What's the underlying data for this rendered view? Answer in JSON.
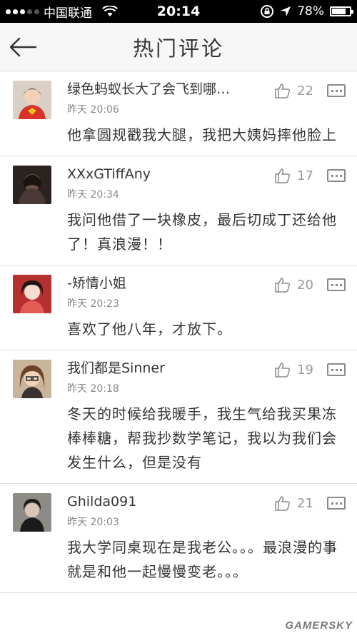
{
  "status_bar": {
    "carrier": "中国联通",
    "time": "20:14",
    "battery": "78%",
    "battery_level": 0.78,
    "signal_bars": 3
  },
  "header": {
    "title": "热门评论",
    "back_icon": "back-arrow-icon"
  },
  "comments": [
    {
      "username": "绿色蚂蚁长大了会飞到哪…",
      "time": "昨天 20:06",
      "likes": "22",
      "text": "他拿圆规戳我大腿，我把大姨妈摔他脸上"
    },
    {
      "username": "XXxGTiffAny",
      "time": "昨天 20:34",
      "likes": "17",
      "text": "我问他借了一块橡皮，最后切成丁还给他了！真浪漫！！"
    },
    {
      "username": "-矫情小姐",
      "time": "昨天 20:23",
      "likes": "20",
      "text": "喜欢了他八年，才放下。"
    },
    {
      "username": "我们都是Sinner",
      "time": "昨天 20:18",
      "likes": "19",
      "text": "冬天的时候给我暖手，我生气给我买果冻棒棒糖，帮我抄数学笔记，我以为我们会发生什么，但是没有"
    },
    {
      "username": "Ghilda091",
      "time": "昨天 20:03",
      "likes": "21",
      "text": "我大学同桌现在是我老公。。。最浪漫的事就是和他一起慢慢变老。。。"
    }
  ],
  "watermark": "GAMERSKY",
  "colors": {
    "status_bar_bg": "#000000",
    "nav_bg": "#f7f7f7",
    "text": "#333333",
    "meta": "#888888"
  }
}
